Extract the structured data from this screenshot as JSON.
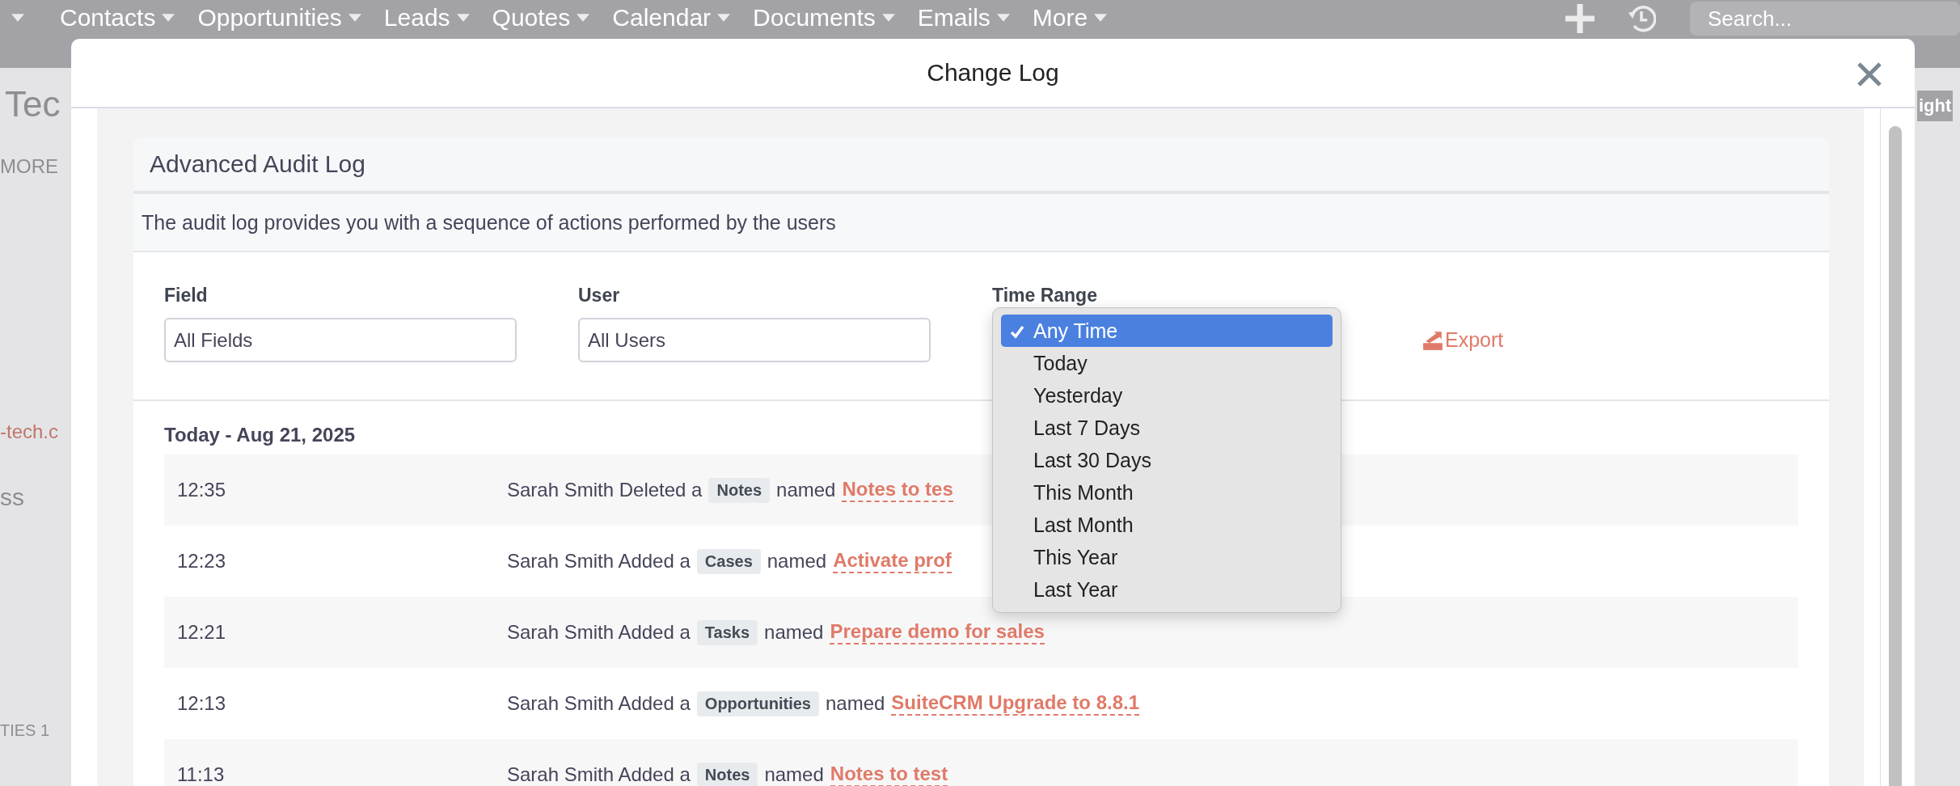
{
  "background_page": {
    "nav_items": [
      "Contacts",
      "Opportunities",
      "Leads",
      "Quotes",
      "Calendar",
      "Documents",
      "Emails",
      "More"
    ],
    "search_placeholder": "Search...",
    "fragments": [
      {
        "kind": "title",
        "text": "Tec"
      },
      {
        "kind": "tab",
        "text": "MORE"
      },
      {
        "kind": "email",
        "text": "-tech.c"
      },
      {
        "kind": "label",
        "text": "ss"
      },
      {
        "kind": "panel",
        "text": "TIES 1"
      }
    ],
    "button_fragment": "ight"
  },
  "modal": {
    "title": "Change Log",
    "card": {
      "title": "Advanced Audit Log",
      "description": "The audit log provides you with a sequence of actions performed by the users",
      "filters": [
        {
          "label": "Field",
          "value": "All Fields"
        },
        {
          "label": "User",
          "value": "All Users"
        }
      ],
      "time_range": {
        "label": "Time Range",
        "options": [
          {
            "label": "Any Time",
            "selected": true
          },
          {
            "label": "Today",
            "selected": false
          },
          {
            "label": "Yesterday",
            "selected": false
          },
          {
            "label": "Last 7 Days",
            "selected": false
          },
          {
            "label": "Last 30 Days",
            "selected": false
          },
          {
            "label": "This Month",
            "selected": false
          },
          {
            "label": "Last Month",
            "selected": false
          },
          {
            "label": "This Year",
            "selected": false
          },
          {
            "label": "Last Year",
            "selected": false
          }
        ]
      },
      "export": "Export",
      "date_heading": "Today - Aug 21, 2025",
      "rows": [
        {
          "time": "12:35",
          "action": "Sarah Smith Deleted a",
          "module": "Notes",
          "connector": "named",
          "record": "Notes to tes"
        },
        {
          "time": "12:23",
          "action": "Sarah Smith Added a",
          "module": "Cases",
          "connector": "named",
          "record": "Activate prof"
        },
        {
          "time": "12:21",
          "action": "Sarah Smith Added a",
          "module": "Tasks",
          "connector": "named",
          "record": "Prepare demo for sales"
        },
        {
          "time": "12:13",
          "action": "Sarah Smith Added a",
          "module": "Opportunities",
          "connector": "named",
          "record": "SuiteCRM Upgrade to 8.8.1"
        },
        {
          "time": "11:13",
          "action": "Sarah Smith Added a",
          "module": "Notes",
          "connector": "named",
          "record": "Notes to test"
        }
      ]
    }
  }
}
